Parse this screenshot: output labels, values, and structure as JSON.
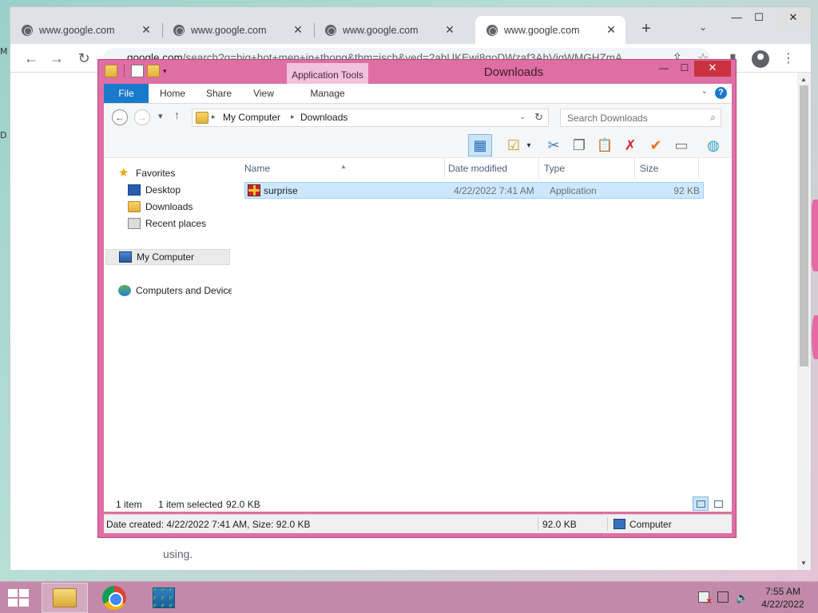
{
  "desktop": {
    "edge_mark_1": "M",
    "edge_mark_2": "D"
  },
  "chrome": {
    "tabs": [
      {
        "title": "www.google.com",
        "active": false
      },
      {
        "title": "www.google.com",
        "active": false
      },
      {
        "title": "www.google.com",
        "active": false
      },
      {
        "title": "www.google.com",
        "active": true
      }
    ],
    "new_tab_glyph": "+",
    "tab_search_glyph": "⌄",
    "window_controls": {
      "minimize": "—",
      "maximize": "☐",
      "close": "✕"
    },
    "nav": {
      "back": "←",
      "forward": "→",
      "reload": "↻"
    },
    "omnibox": {
      "host": "google.com",
      "path": "/search?q=big+hot+men+in+thong&tbm=isch&ved=2ahUKEwi8goDWzaf3AhVigWMGHZmA"
    },
    "toolbar_icons": {
      "share": "⇪",
      "bookmark": "☆",
      "sidepanel": "▮",
      "menu": "⋮"
    },
    "page_text": "using."
  },
  "explorer": {
    "title": "Downloads",
    "context_tab_group": "Application Tools",
    "ribbon_tabs": [
      "File",
      "Home",
      "Share",
      "View",
      "Manage"
    ],
    "window_controls": {
      "minimize": "—",
      "maximize": "☐",
      "close": "✕"
    },
    "ribbon_help": "?",
    "ribbon_expand": "⌄",
    "address": {
      "crumbs": [
        "My Computer",
        "Downloads"
      ],
      "separator": "▸"
    },
    "search_placeholder": "Search Downloads",
    "nav_buttons": {
      "back": "←",
      "forward": "→",
      "recent": "▾",
      "up": "↑",
      "refresh": "↻",
      "dropdown": "⌄",
      "search": "⌕"
    },
    "command_icons": [
      "▦",
      "☑",
      "▾",
      "✂",
      "❐",
      "📋",
      "✗",
      "✔",
      "▭",
      "◍"
    ],
    "nav_pane": {
      "favorites_label": "Favorites",
      "favorites": [
        "Desktop",
        "Downloads",
        "Recent places"
      ],
      "computer": "My Computer",
      "network": "Computers and Devices"
    },
    "columns": [
      "Name",
      "Date modified",
      "Type",
      "Size"
    ],
    "sort_indicator": "▲",
    "files": [
      {
        "name": "surprise",
        "date_modified": "4/22/2022 7:41 AM",
        "type": "Application",
        "size": "92 KB"
      }
    ],
    "status": {
      "item_count": "1 item",
      "selected": "1 item selected",
      "selected_size": "92.0 KB"
    },
    "details": {
      "created": "Date created: 4/22/2022 7:41 AM, Size: 92.0 KB",
      "size": "92.0 KB",
      "location": "Computer"
    },
    "colors": {
      "frame": "#de6ea3",
      "selection": "#cce8ff",
      "file_tab": "#1979ca"
    }
  },
  "taskbar": {
    "clock_time": "7:55 AM",
    "clock_date": "4/22/2022",
    "apps": [
      "file-explorer",
      "google-chrome",
      "package-installer"
    ]
  }
}
